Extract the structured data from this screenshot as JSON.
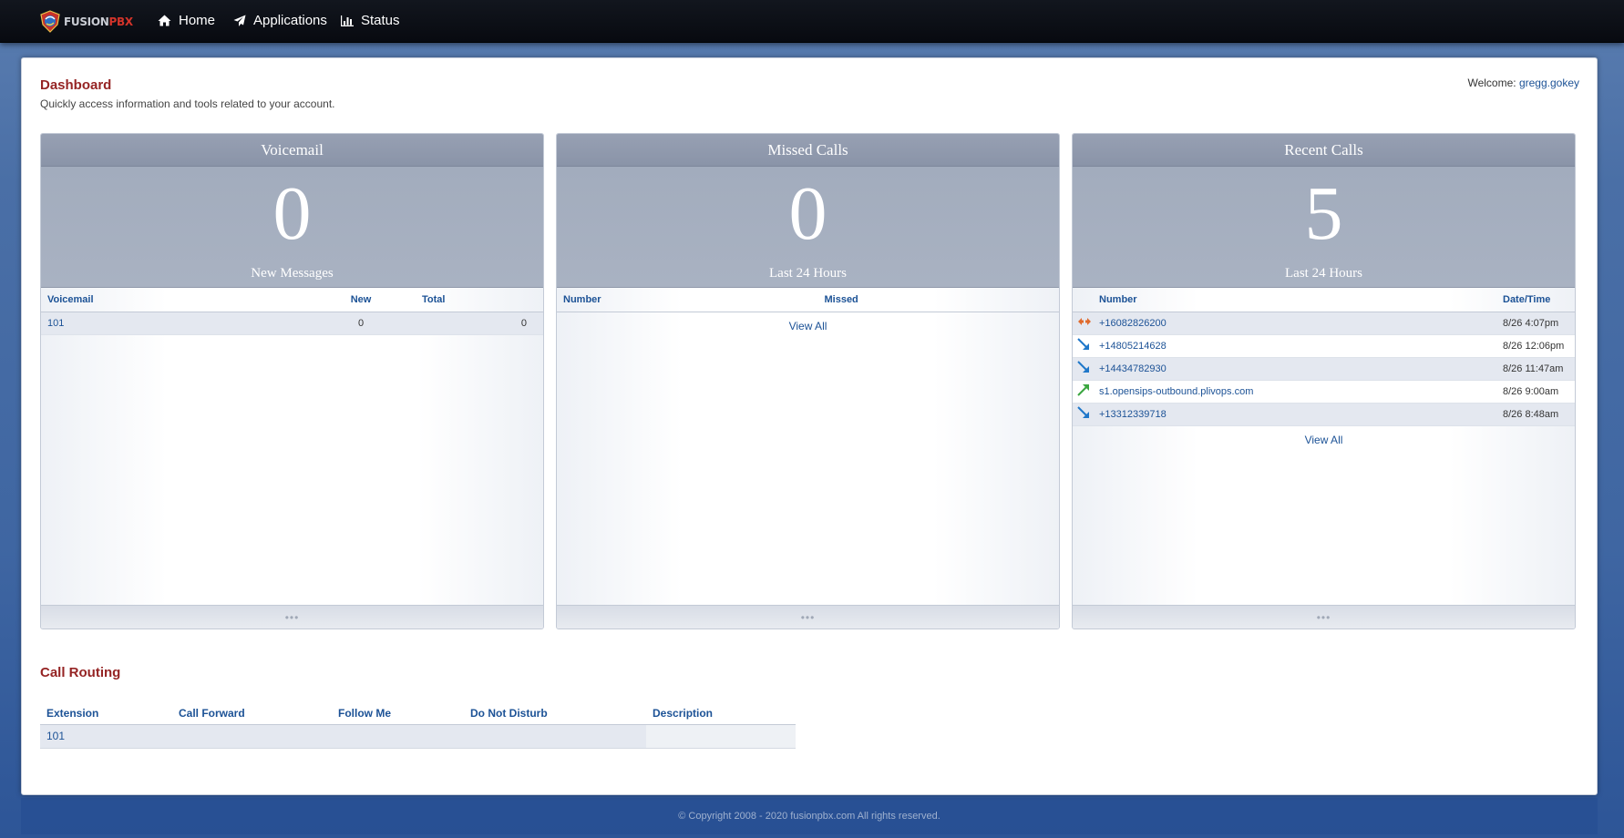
{
  "nav": {
    "logo_fusion": "FUSION",
    "logo_pbx": "PBX",
    "items": [
      {
        "label": "Home",
        "icon": "home-icon"
      },
      {
        "label": "Applications",
        "icon": "paper-plane-icon"
      },
      {
        "label": "Status",
        "icon": "bar-chart-icon"
      }
    ]
  },
  "page": {
    "title": "Dashboard",
    "subtitle": "Quickly access information and tools related to your account.",
    "welcome_label": "Welcome:",
    "username": "gregg.gokey"
  },
  "voicemail": {
    "title": "Voicemail",
    "count": "0",
    "caption": "New Messages",
    "headers": {
      "voicemail": "Voicemail",
      "new": "New",
      "total": "Total"
    },
    "rows": [
      {
        "voicemail": "101",
        "new": "0",
        "total": "0"
      }
    ],
    "footer": "•••"
  },
  "missed": {
    "title": "Missed Calls",
    "count": "0",
    "caption": "Last 24 Hours",
    "headers": {
      "number": "Number",
      "missed": "Missed"
    },
    "view_all": "View All",
    "footer": "•••"
  },
  "recent": {
    "title": "Recent Calls",
    "count": "5",
    "caption": "Last 24 Hours",
    "headers": {
      "number": "Number",
      "datetime": "Date/Time"
    },
    "rows": [
      {
        "direction": "local",
        "icon": "local-call-icon",
        "number": "+16082826200",
        "datetime": "8/26 4:07pm"
      },
      {
        "direction": "inbound",
        "icon": "inbound-call-icon",
        "number": "+14805214628",
        "datetime": "8/26 12:06pm"
      },
      {
        "direction": "inbound",
        "icon": "inbound-call-icon",
        "number": "+14434782930",
        "datetime": "8/26 11:47am"
      },
      {
        "direction": "outbound",
        "icon": "outbound-call-icon",
        "number": "s1.opensips-outbound.plivops.com",
        "datetime": "8/26 9:00am"
      },
      {
        "direction": "inbound",
        "icon": "inbound-call-icon",
        "number": "+13312339718",
        "datetime": "8/26 8:48am"
      }
    ],
    "view_all": "View All",
    "footer": "•••"
  },
  "call_routing": {
    "title": "Call Routing",
    "headers": {
      "extension": "Extension",
      "call_forward": "Call Forward",
      "follow_me": "Follow Me",
      "dnd": "Do Not Disturb",
      "description": "Description"
    },
    "rows": [
      {
        "extension": "101",
        "call_forward": "",
        "follow_me": "",
        "dnd": "",
        "description": ""
      }
    ]
  },
  "footer": {
    "copyright": "© Copyright 2008 - 2020 fusionpbx.com All rights reserved."
  },
  "colors": {
    "accent_red": "#952424",
    "link_blue": "#1c5296",
    "inbound": "#1f77c9",
    "outbound": "#3aa640",
    "local": "#e06a2c"
  }
}
